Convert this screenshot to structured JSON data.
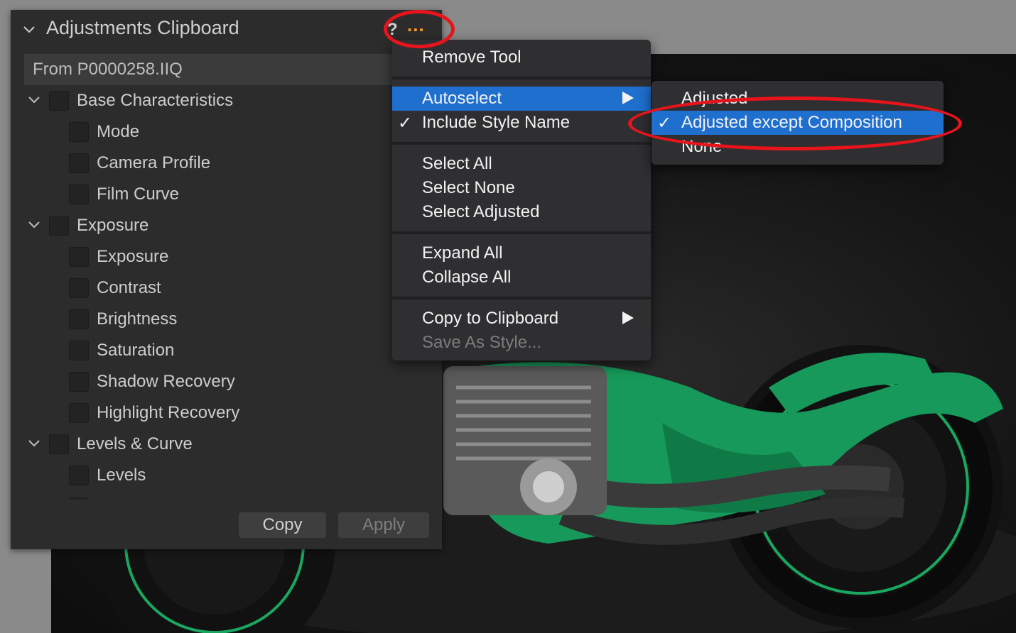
{
  "panel": {
    "title": "Adjustments Clipboard",
    "help_label": "?",
    "more_label": "...",
    "source": "From P0000258.IIQ",
    "tree": [
      {
        "label": "Base Characteristics",
        "level": 0
      },
      {
        "label": "Mode",
        "level": 1
      },
      {
        "label": "Camera Profile",
        "level": 1
      },
      {
        "label": "Film Curve",
        "level": 1
      },
      {
        "label": "Exposure",
        "level": 0
      },
      {
        "label": "Exposure",
        "level": 1
      },
      {
        "label": "Contrast",
        "level": 1
      },
      {
        "label": "Brightness",
        "level": 1
      },
      {
        "label": "Saturation",
        "level": 1
      },
      {
        "label": "Shadow Recovery",
        "level": 1
      },
      {
        "label": "Highlight Recovery",
        "level": 1
      },
      {
        "label": "Levels & Curve",
        "level": 0
      },
      {
        "label": "Levels",
        "level": 1
      }
    ],
    "copy_label": "Copy",
    "apply_label": "Apply"
  },
  "menu": {
    "remove_tool": "Remove Tool",
    "autoselect": "Autoselect",
    "include_style_name": "Include Style Name",
    "include_style_checked": "✓",
    "select_all": "Select All",
    "select_none": "Select None",
    "select_adjusted": "Select Adjusted",
    "expand_all": "Expand All",
    "collapse_all": "Collapse All",
    "copy_to_clipboard": "Copy to Clipboard",
    "save_as_style": "Save As Style..."
  },
  "submenu": {
    "adjusted": "Adjusted",
    "adjusted_except_composition": "Adjusted except Composition",
    "selected_check": "✓",
    "none": "None"
  },
  "colors": {
    "highlight": "#1f6fcf",
    "annotation": "#e8141c",
    "more_icon": "#ff9a1f",
    "bike_green": "#1aa860"
  }
}
